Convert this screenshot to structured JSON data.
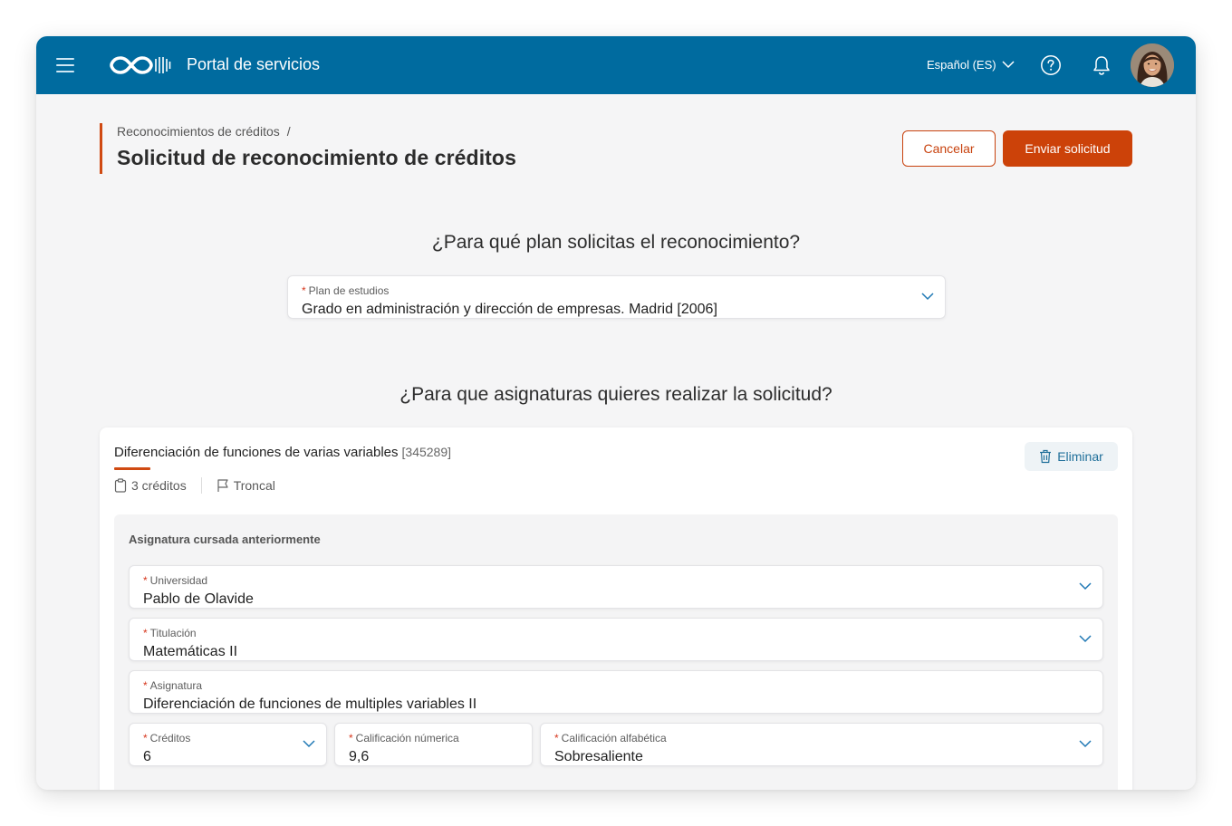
{
  "header": {
    "app_title": "Portal de servicios",
    "language": "Español (ES)",
    "icons": {
      "menu": "hamburger-icon",
      "help": "help-icon",
      "notifications": "bell-icon",
      "logo": "infinity-logo"
    },
    "brand_color": "#006b9f"
  },
  "page": {
    "breadcrumb": [
      "Reconocimientos de créditos",
      "/"
    ],
    "title": "Solicitud de reconocimiento de créditos",
    "cancel_label": "Cancelar",
    "send_label": "Enviar solicitud",
    "accent_color": "#cc4209"
  },
  "plan_section": {
    "question": "¿Para qué plan solicitas el reconocimiento?",
    "field": {
      "label": "Plan de estudios",
      "value": "Grado en administración y dirección de empresas. Madrid [2006]"
    }
  },
  "subjects_section": {
    "question": "¿Para que asignaturas quieres realizar la solicitud?",
    "subject": {
      "name": "Diferenciación de funciones de varias variables",
      "code": "[345289]",
      "credits": "3 créditos",
      "type": "Troncal",
      "delete_label": "Eliminar",
      "prior": {
        "title": "Asignatura cursada anteriormente",
        "universidad": {
          "label": "Universidad",
          "value": "Pablo de Olavide"
        },
        "titulacion": {
          "label": "Titulación",
          "value": "Matemáticas II"
        },
        "asignatura": {
          "label": "Asignatura",
          "value": "Diferenciación de funciones de multiples variables II"
        },
        "creditos": {
          "label": "Créditos",
          "value": "6"
        },
        "calif_num": {
          "label": "Calificación númerica",
          "value": "9,6"
        },
        "calif_alfa": {
          "label": "Calificación alfabética",
          "value": "Sobresaliente"
        }
      }
    }
  }
}
